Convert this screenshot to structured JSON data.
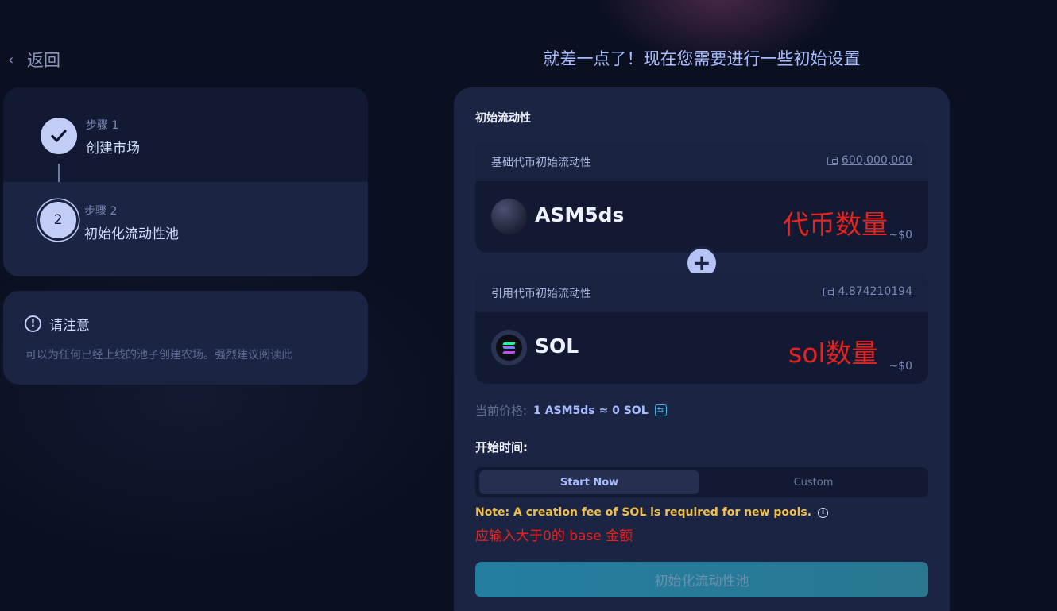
{
  "nav": {
    "back_label": "返回"
  },
  "steps": [
    {
      "kicker": "步骤 1",
      "title": "创建市场",
      "status": "complete"
    },
    {
      "kicker": "步骤 2",
      "title": "初始化流动性池",
      "number": "2",
      "status": "active"
    }
  ],
  "notice": {
    "title": "请注意",
    "body": "可以为任何已经上线的池子创建农场。强烈建议阅读此"
  },
  "heading": "就差一点了！现在您需要进行一些初始设置",
  "liquidity": {
    "section_label": "初始流动性",
    "base": {
      "label": "基础代币初始流动性",
      "balance": "600,000,000",
      "symbol": "ASM5ds",
      "annotation": "代币数量",
      "usd": "~$0"
    },
    "quote": {
      "label": "引用代币初始流动性",
      "balance": "4.874210194",
      "symbol": "SOL",
      "annotation": "sol数量",
      "usd": "~$0"
    },
    "plus_symbol": "+"
  },
  "price": {
    "label": "当前价格:",
    "value": "1 ASM5ds ≈ 0 SOL"
  },
  "start_time": {
    "label": "开始时间:",
    "options": [
      "Start Now",
      "Custom"
    ],
    "selected": "Start Now"
  },
  "fee_note": "Note: A creation fee of  SOL is required for new pools.",
  "error_note": "应输入大于0的 base 金额",
  "submit_label": "初始化流动性池",
  "colors": {
    "accent": "#a9bbff",
    "warning": "#f0c04a",
    "error": "#e8231f",
    "button": "#237ea0"
  }
}
